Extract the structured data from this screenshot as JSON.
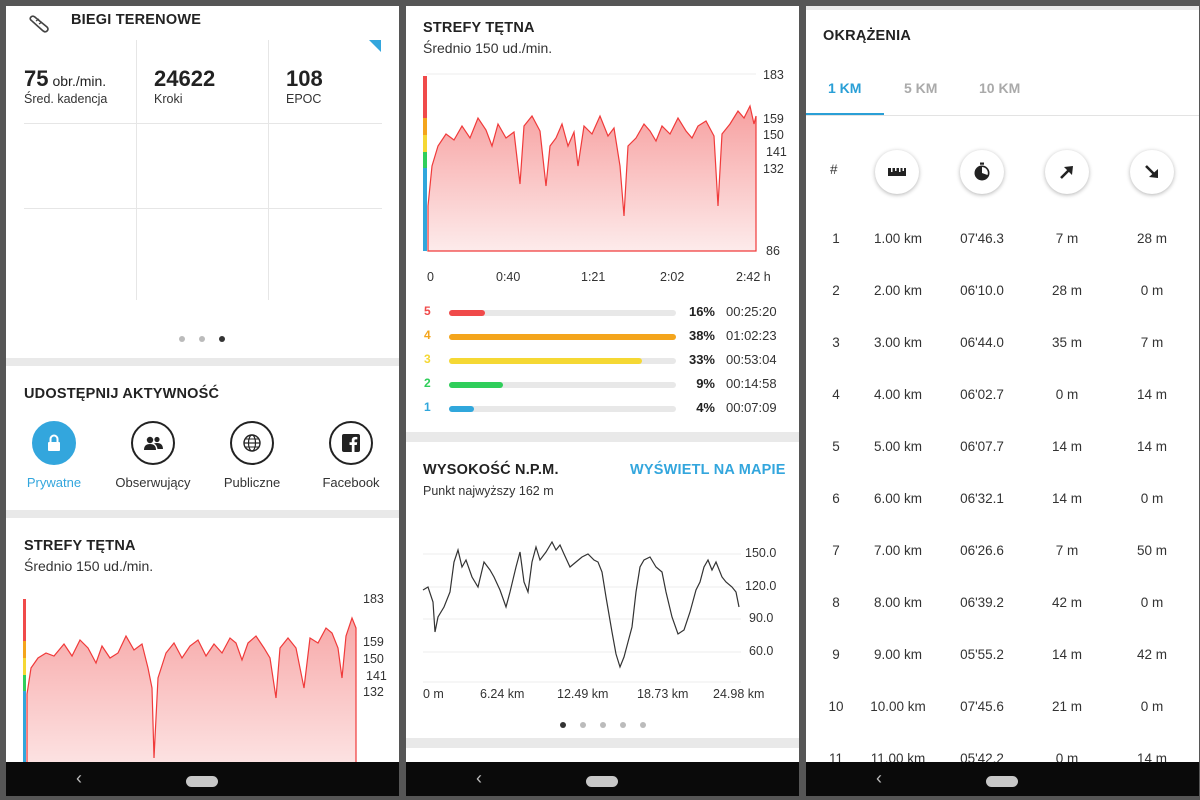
{
  "screen1": {
    "activity_title": "BIEGI TERENOWE",
    "stats": [
      {
        "value": "75",
        "unit": "obr./min.",
        "label": "Śred. kadencja"
      },
      {
        "value": "24622",
        "unit": "",
        "label": "Kroki"
      },
      {
        "value": "108",
        "unit": "",
        "label": "EPOC"
      }
    ],
    "share_title": "UDOSTĘPNIJ AKTYWNOŚĆ",
    "share_options": [
      {
        "label": "Prywatne",
        "icon": "lock-icon",
        "active": true
      },
      {
        "label": "Obserwujący",
        "icon": "followers-icon",
        "active": false
      },
      {
        "label": "Publiczne",
        "icon": "globe-icon",
        "active": false
      },
      {
        "label": "Facebook",
        "icon": "facebook-icon",
        "active": false
      }
    ],
    "hr_title": "STREFY TĘTNA",
    "hr_sub": "Średnio 150 ud./min.",
    "hr_ticks": [
      "183",
      "159",
      "150",
      "141",
      "132"
    ]
  },
  "screen2": {
    "hr_title": "STREFY TĘTNA",
    "hr_sub": "Średnio 150 ud./min.",
    "hr_ticks": [
      "183",
      "159",
      "150",
      "141",
      "132",
      "86"
    ],
    "hr_xticks": [
      "0",
      "0:40",
      "1:21",
      "2:02",
      "2:42 h"
    ],
    "zones": [
      {
        "zone": "5",
        "percent": "16%",
        "fraction": 0.16,
        "time": "00:25:20",
        "color": "#f04a4a"
      },
      {
        "zone": "4",
        "percent": "38%",
        "fraction": 0.38,
        "time": "01:02:23",
        "color": "#f4a51c"
      },
      {
        "zone": "3",
        "percent": "33%",
        "fraction": 0.33,
        "time": "00:53:04",
        "color": "#f5d834"
      },
      {
        "zone": "2",
        "percent": "9%",
        "fraction": 0.09,
        "time": "00:14:58",
        "color": "#2fce5a"
      },
      {
        "zone": "1",
        "percent": "4%",
        "fraction": 0.04,
        "time": "00:07:09",
        "color": "#30a7dc"
      }
    ],
    "alt_title": "WYSOKOŚĆ N.P.M.",
    "alt_link": "WYŚWIETL NA MAPIE",
    "alt_sub": "Punkt najwyższy 162 m",
    "alt_yticks": [
      "150.0",
      "120.0",
      "90.0",
      "60.0"
    ],
    "alt_xticks": [
      "0 m",
      "6.24 km",
      "12.49 km",
      "18.73 km",
      "24.98 km"
    ]
  },
  "screen3": {
    "title": "OKRĄŻENIA",
    "tabs": [
      "1 KM",
      "5 KM",
      "10 KM"
    ],
    "hash": "#",
    "columns": [
      {
        "icon": "distance-ruler-icon"
      },
      {
        "icon": "stopwatch-icon"
      },
      {
        "icon": "ascent-arrow-icon"
      },
      {
        "icon": "descent-arrow-icon"
      }
    ],
    "laps": [
      [
        "1",
        "1.00 km",
        "07'46.3",
        "7 m",
        "28 m"
      ],
      [
        "2",
        "2.00 km",
        "06'10.0",
        "28 m",
        "0 m"
      ],
      [
        "3",
        "3.00 km",
        "06'44.0",
        "35 m",
        "7 m"
      ],
      [
        "4",
        "4.00 km",
        "06'02.7",
        "0 m",
        "14 m"
      ],
      [
        "5",
        "5.00 km",
        "06'07.7",
        "14 m",
        "14 m"
      ],
      [
        "6",
        "6.00 km",
        "06'32.1",
        "14 m",
        "0 m"
      ],
      [
        "7",
        "7.00 km",
        "06'26.6",
        "7 m",
        "50 m"
      ],
      [
        "8",
        "8.00 km",
        "06'39.2",
        "42 m",
        "0 m"
      ],
      [
        "9",
        "9.00 km",
        "05'55.2",
        "14 m",
        "42 m"
      ],
      [
        "10",
        "10.00 km",
        "07'45.6",
        "21 m",
        "0 m"
      ],
      [
        "11",
        "11.00 km",
        "05'42.2",
        "0 m",
        "14 m"
      ]
    ]
  },
  "colors": {
    "accent": "#33a6dd",
    "hr_line": "#f03a3a",
    "zone5": "#f04a4a",
    "zone4": "#f4a51c",
    "zone3": "#f5d834",
    "zone2": "#2fce5a",
    "zone1": "#30a7dc"
  },
  "chart_data": [
    {
      "type": "area",
      "title": "STREFY TĘTNA",
      "ylim": [
        86,
        183
      ],
      "yticks": [
        183,
        159,
        150,
        141,
        132,
        86
      ],
      "xticks": [
        "0",
        "0:40",
        "1:21",
        "2:02",
        "2:42 h"
      ],
      "average": 150
    },
    {
      "type": "bar",
      "categories": [
        "5",
        "4",
        "3",
        "2",
        "1"
      ],
      "values": [
        16,
        38,
        33,
        9,
        4
      ]
    },
    {
      "type": "line",
      "title": "WYSOKOŚĆ N.P.M.",
      "xticks": [
        "0 m",
        "6.24 km",
        "12.49 km",
        "18.73 km",
        "24.98 km"
      ],
      "yticks": [
        150,
        120,
        90,
        60
      ],
      "x": [
        0,
        1,
        2,
        3,
        4,
        5,
        6,
        7,
        8,
        9,
        10,
        11,
        12,
        13,
        14,
        15,
        16,
        17,
        18,
        19,
        20,
        21,
        22,
        23,
        24,
        25
      ],
      "y": [
        108,
        100,
        140,
        125,
        110,
        118,
        135,
        140,
        106,
        142,
        110,
        125,
        148,
        148,
        133,
        144,
        125,
        60,
        70,
        110,
        128,
        132,
        95,
        110,
        128,
        102
      ]
    }
  ]
}
